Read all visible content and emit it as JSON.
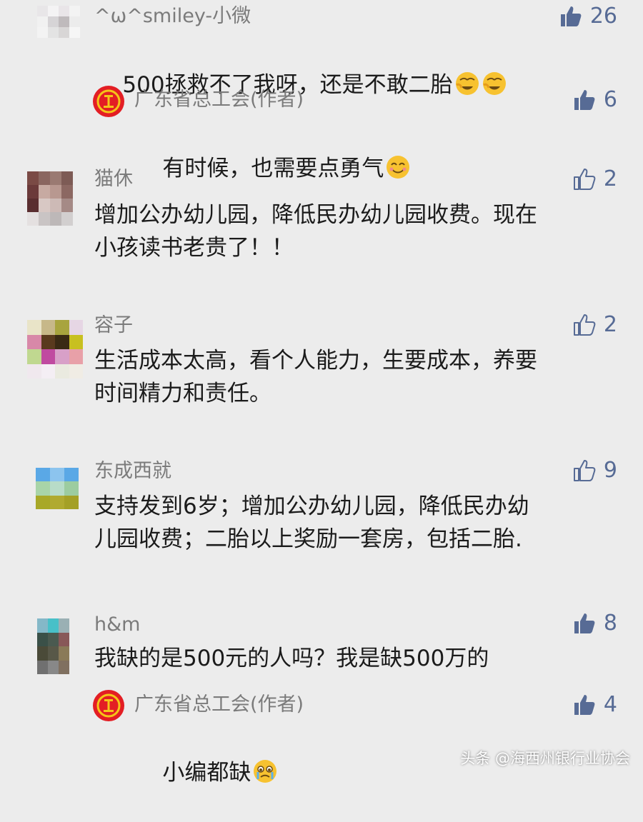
{
  "comments": [
    {
      "name": "^ω^smiley-小微",
      "text": "500拯救不了我呀，还是不敢二胎",
      "likes": "26",
      "liked": true,
      "reply": {
        "name": "广东省总工会(作者)",
        "text": "有时候，也需要点勇气",
        "likes": "6",
        "liked": true
      }
    },
    {
      "name": "猫休",
      "text": "增加公办幼儿园，降低民办幼儿园收费。现在\n小孩读书老贵了！！",
      "likes": "2",
      "liked": false
    },
    {
      "name": "容子",
      "text": "生活成本太高，看个人能力，生要成本，养要\n时间精力和责任。",
      "likes": "2",
      "liked": false
    },
    {
      "name": "东成西就",
      "text": "支持发到6岁；增加公办幼儿园，降低民办幼\n儿园收费；二胎以上奖励一套房，包括二胎.",
      "likes": "9",
      "liked": false
    },
    {
      "name": "h&m",
      "text": "我缺的是500元的人吗？我是缺500万的",
      "likes": "8",
      "liked": true,
      "reply": {
        "name": "广东省总工会(作者)",
        "text": "小编都缺",
        "likes": "4",
        "liked": true
      }
    }
  ],
  "watermark": "头条 @海西州银行业协会",
  "icons": {
    "like": "thumbs-up-icon",
    "author_logo": "trade-union-logo",
    "emoji_facepalm": "facepalm-laugh-emoji",
    "emoji_smile": "smiling-face-emoji",
    "emoji_crying": "crying-face-emoji"
  },
  "colors": {
    "background": "#ececec",
    "name": "#7b7b7b",
    "like": "#576b95",
    "author_logo": "#e31e24"
  }
}
